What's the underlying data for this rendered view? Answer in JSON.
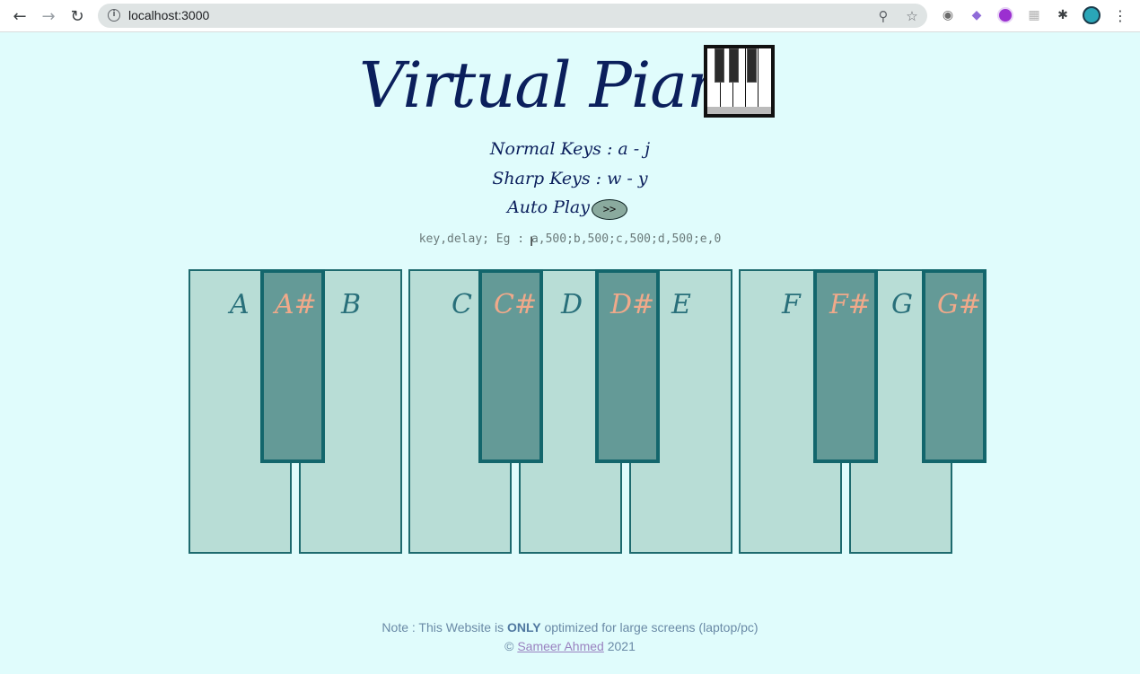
{
  "browser": {
    "url": "localhost:3000"
  },
  "header": {
    "title": "Virtual Piano"
  },
  "instructions": {
    "normal_keys": "Normal Keys : a - j",
    "sharp_keys": "Sharp Keys : w - y",
    "auto_play_label": "Auto Play :",
    "play_button_label": ">>"
  },
  "sequence_input": {
    "value": "key,delay; Eg : a,500;b,500;c,500;d,500;e,0"
  },
  "piano": {
    "white_keys": [
      "A",
      "B",
      "C",
      "D",
      "E",
      "F",
      "G"
    ],
    "black_keys": [
      "A#",
      "C#",
      "D#",
      "F#",
      "G#"
    ]
  },
  "footer": {
    "note_prefix": "Note : This Website is ",
    "note_emphasis": "ONLY",
    "note_suffix": " optimized for large screens (laptop/pc)",
    "copyright_symbol": "©",
    "author": "Sameer Ahmed",
    "year": "2021"
  },
  "colors": {
    "background": "#e0fcfc",
    "white_key": "#b8ddd6",
    "black_key": "#649a97",
    "key_border": "#13666c",
    "title": "#0b1f5c",
    "sharp_label": "#f0a98a"
  }
}
